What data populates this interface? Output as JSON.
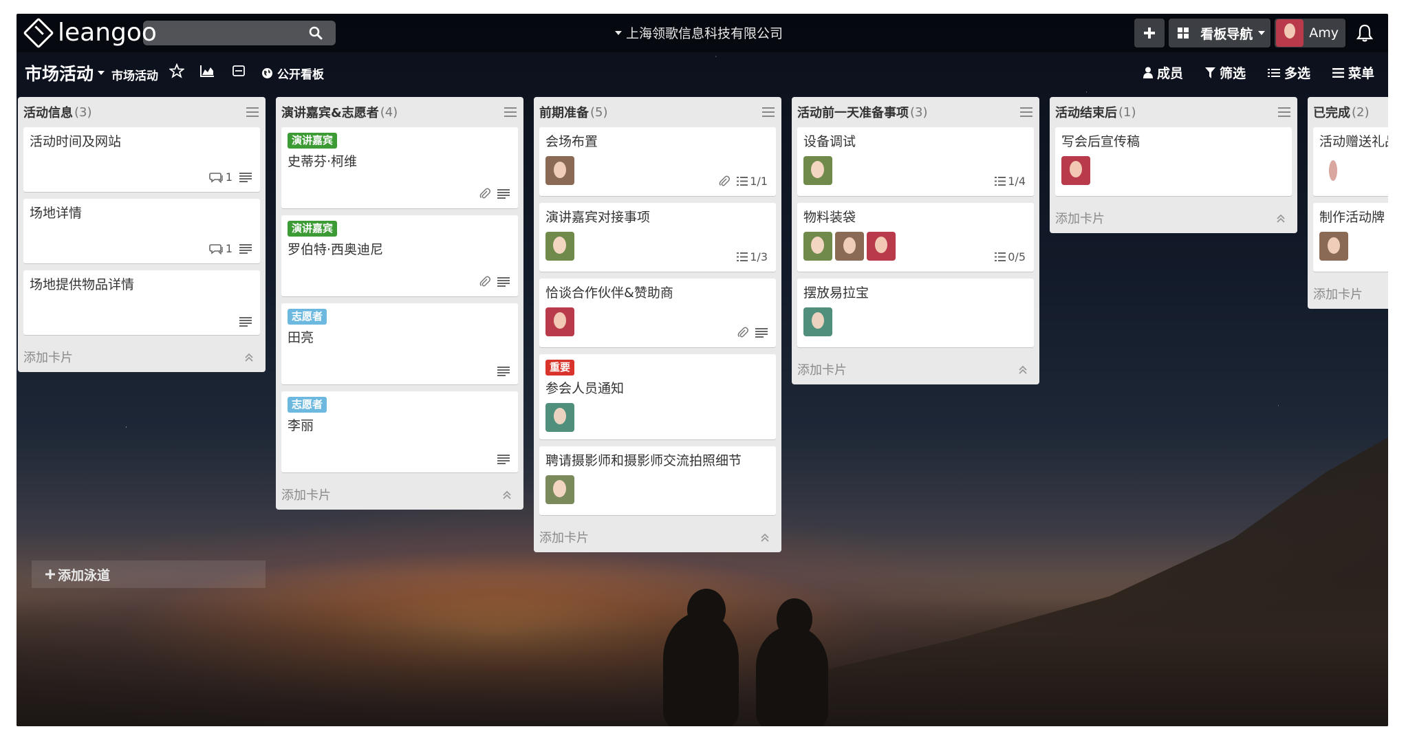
{
  "app": {
    "logo_text": "leangoo",
    "search_value": "",
    "org_name": "上海领歌信息科技有限公司",
    "nav_label": "看板导航",
    "user_name": "Amy"
  },
  "board": {
    "title": "市场活动",
    "subtitle": "市场活动",
    "visibility": "公开看板",
    "actions": {
      "members": "成员",
      "filter": "筛选",
      "multi_select": "多选",
      "menu": "菜单"
    },
    "add_lane": "添加泳道"
  },
  "colors": {
    "label_green": "#3d9b35",
    "label_blue": "#6cb8de",
    "label_red": "#d9342b"
  },
  "lists": [
    {
      "title": "活动信息",
      "count": "(3)",
      "add_card": "添加卡片",
      "cards": [
        {
          "title": "活动时间及网站",
          "comments": "1"
        },
        {
          "title": "场地详情",
          "comments": "1"
        },
        {
          "title": "场地提供物品详情"
        }
      ]
    },
    {
      "title": "演讲嘉宾&志愿者",
      "count": "(4)",
      "add_card": "添加卡片",
      "cards": [
        {
          "label": "演讲嘉宾",
          "title": "史蒂芬·柯维"
        },
        {
          "label": "演讲嘉宾",
          "title": "罗伯特·西奥迪尼"
        },
        {
          "label": "志愿者",
          "title": "田亮"
        },
        {
          "label": "志愿者",
          "title": "李丽"
        }
      ]
    },
    {
      "title": "前期准备",
      "count": "(5)",
      "add_card": "添加卡片",
      "cards": [
        {
          "title": "会场布置",
          "checklist": "1/1"
        },
        {
          "title": "演讲嘉宾对接事项",
          "checklist": "1/3"
        },
        {
          "title": "恰谈合作伙伴&赞助商"
        },
        {
          "label": "重要",
          "title": "参会人员通知"
        },
        {
          "title": "聘请摄影师和摄影师交流拍照细节"
        }
      ]
    },
    {
      "title": "活动前一天准备事项",
      "count": "(3)",
      "add_card": "添加卡片",
      "cards": [
        {
          "title": "设备调试",
          "checklist": "1/4"
        },
        {
          "title": "物料装袋",
          "checklist": "0/5"
        },
        {
          "title": "摆放易拉宝"
        }
      ]
    },
    {
      "title": "活动结束后",
      "count": "(1)",
      "add_card": "添加卡片",
      "cards": [
        {
          "title": "写会后宣传稿"
        }
      ]
    },
    {
      "title": "已完成",
      "count": "(2)",
      "add_card": "添加卡片",
      "cards": [
        {
          "title": "活动赠送礼品"
        },
        {
          "title": "制作活动牌"
        }
      ]
    }
  ]
}
